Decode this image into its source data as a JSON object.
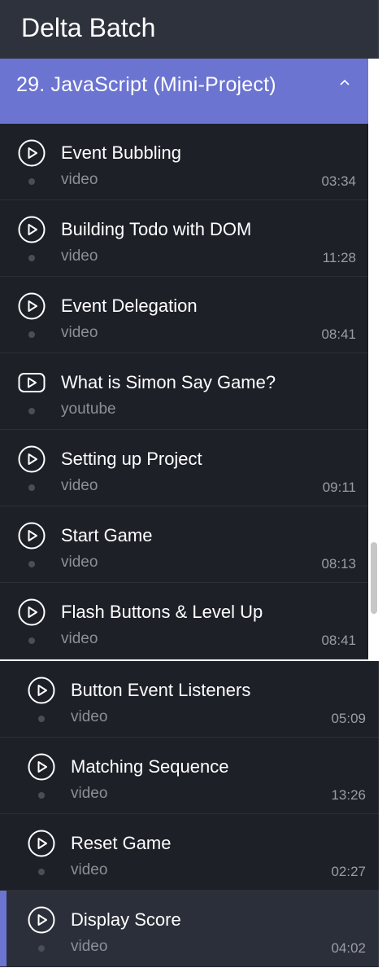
{
  "header": {
    "title": "Delta Batch"
  },
  "section": {
    "title": "29. JavaScript (Mini-Project)",
    "expanded": true,
    "chevron_icon": "chevron-up-icon"
  },
  "colors": {
    "accent": "#6b74d0",
    "background": "#1e2028",
    "header": "#2e323c",
    "active": "#2b2f39"
  },
  "lessons_upper": [
    {
      "title": "Event Bubbling",
      "type": "video",
      "duration": "03:34",
      "icon": "play-circle-icon"
    },
    {
      "title": "Building Todo with DOM",
      "type": "video",
      "duration": "11:28",
      "icon": "play-circle-icon"
    },
    {
      "title": "Event Delegation",
      "type": "video",
      "duration": "08:41",
      "icon": "play-circle-icon"
    },
    {
      "title": "What is Simon Say Game?",
      "type": "youtube",
      "duration": "",
      "icon": "youtube-play-icon"
    },
    {
      "title": "Setting up Project",
      "type": "video",
      "duration": "09:11",
      "icon": "play-circle-icon"
    },
    {
      "title": "Start Game",
      "type": "video",
      "duration": "08:13",
      "icon": "play-circle-icon"
    },
    {
      "title": "Flash Buttons & Level Up",
      "type": "video",
      "duration": "08:41",
      "icon": "play-circle-icon"
    }
  ],
  "lessons_lower": [
    {
      "title": "Button Event Listeners",
      "type": "video",
      "duration": "05:09",
      "icon": "play-circle-icon"
    },
    {
      "title": "Matching Sequence",
      "type": "video",
      "duration": "13:26",
      "icon": "play-circle-icon"
    },
    {
      "title": "Reset Game",
      "type": "video",
      "duration": "02:27",
      "icon": "play-circle-icon"
    },
    {
      "title": "Display Score",
      "type": "video",
      "duration": "04:02",
      "icon": "play-circle-icon",
      "active": true
    }
  ]
}
